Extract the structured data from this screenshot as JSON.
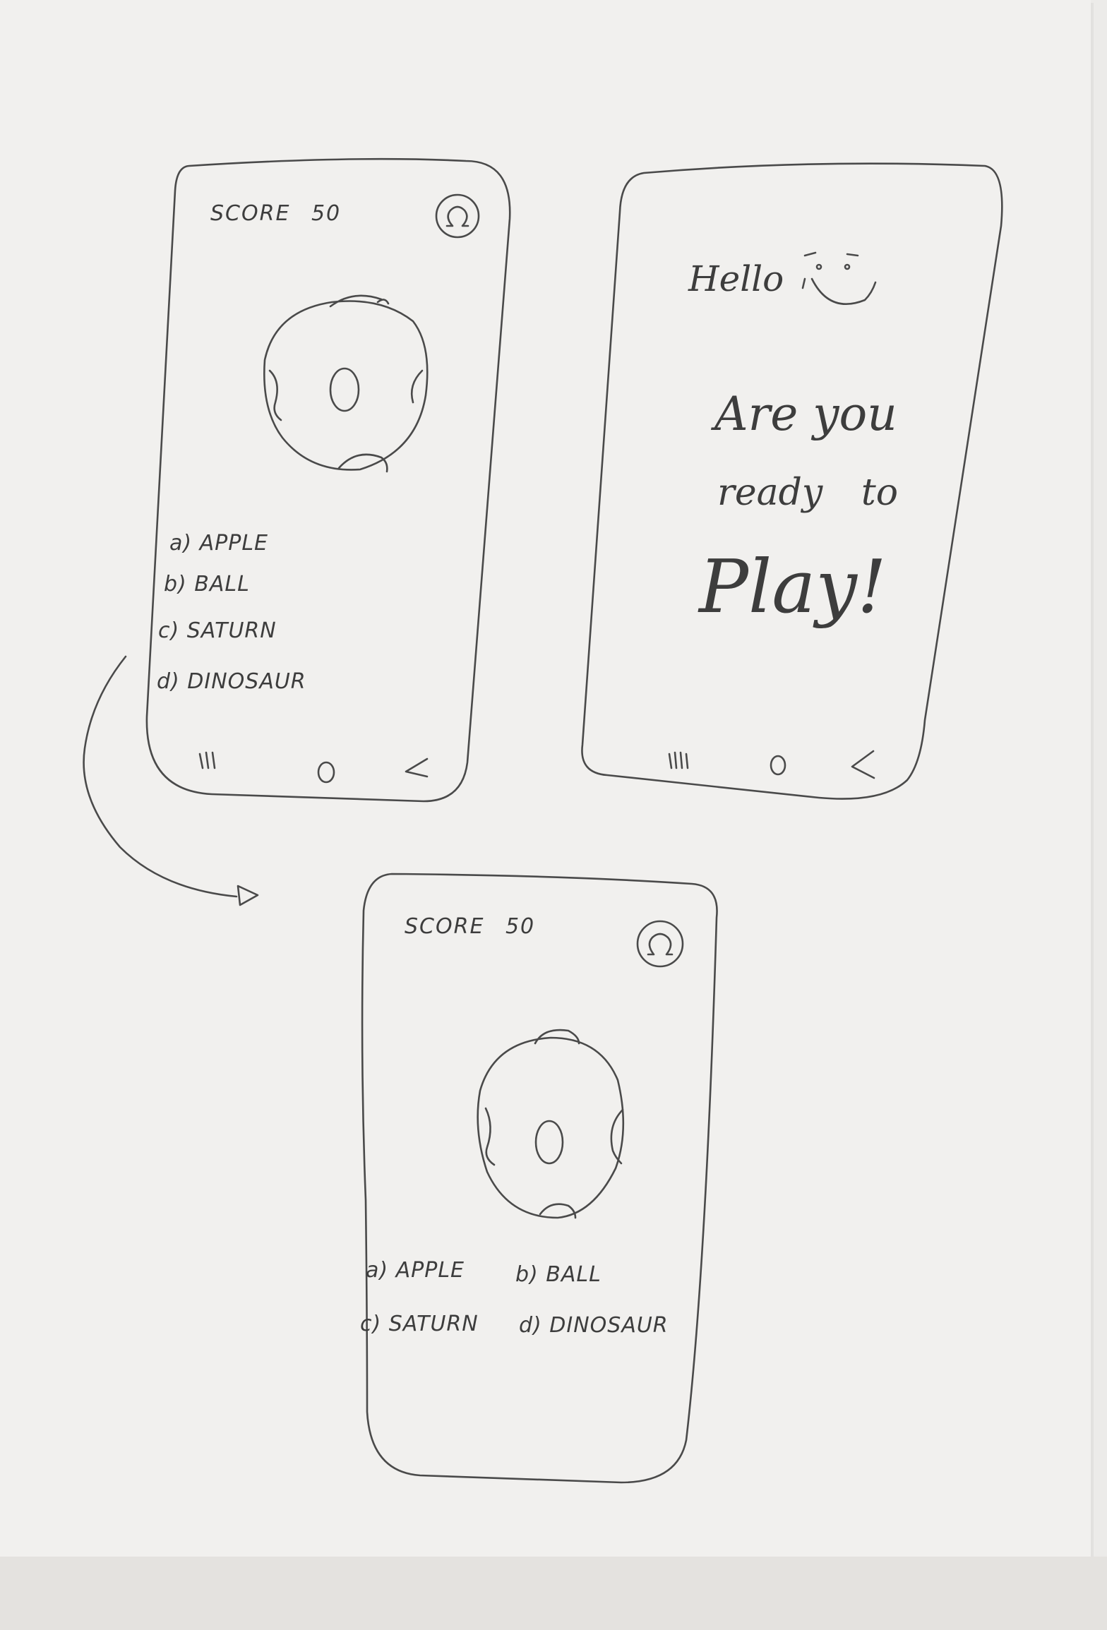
{
  "screens": {
    "quiz_list": {
      "score_label": "SCORE",
      "score_value": "50",
      "profile_icon": "omega-icon",
      "options": [
        "a) APPLE",
        "b) BALL",
        "c) SATURN",
        "d) DINOSAUR"
      ],
      "nav": [
        "recent-apps-icon",
        "home-icon",
        "back-icon"
      ]
    },
    "welcome": {
      "greeting": "Hello",
      "line1": "Are you",
      "line2": "ready",
      "line2b": "to",
      "line3": "Play!",
      "nav": [
        "recent-apps-icon",
        "home-icon",
        "back-icon"
      ]
    },
    "quiz_grid": {
      "score_label": "SCORE",
      "score_value": "50",
      "profile_icon": "omega-icon",
      "options": [
        "a) APPLE",
        "b) BALL",
        "c) SATURN",
        "d) DINOSAUR"
      ]
    }
  },
  "colors": {
    "pencil": "#3d3d3d",
    "paper": "#f1f0ee"
  }
}
